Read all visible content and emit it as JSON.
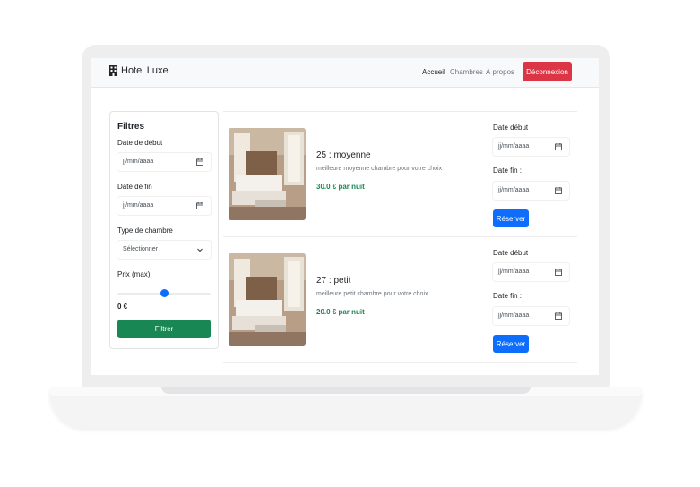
{
  "brand": {
    "name": "Hotel Luxe",
    "icon": "building-icon"
  },
  "nav": {
    "items": [
      "Accueil",
      "Chambres",
      "À propos"
    ],
    "logout": "Déconnexion"
  },
  "filters": {
    "title": "Filtres",
    "start_label": "Date de début",
    "start_placeholder": "jj/mm/aaaa",
    "end_label": "Date de fin",
    "end_placeholder": "jj/mm/aaaa",
    "type_label": "Type de chambre",
    "type_selected": "Sélectionner",
    "price_label": "Prix (max)",
    "price_level": 0.5,
    "price_value": "0 €",
    "submit": "Filtrer"
  },
  "rooms": [
    {
      "title": "25 : moyenne",
      "description": "meilleure moyenne chambre pour votre choix",
      "price": "30.0 € par nuit",
      "start_label": "Date début :",
      "start_placeholder": "jj/mm/aaaa",
      "end_label": "Date fin :",
      "end_placeholder": "jj/mm/aaaa",
      "button": "Réserver"
    },
    {
      "title": "27 : petit",
      "description": "meilleure petit chambre pour votre choix",
      "price": "20.0 € par nuit",
      "start_label": "Date début :",
      "start_placeholder": "jj/mm/aaaa",
      "end_label": "Date fin :",
      "end_placeholder": "jj/mm/aaaa",
      "button": "Réserver"
    }
  ],
  "colors": {
    "danger": "#dc3545",
    "success": "#198754",
    "primary": "#0d6efd"
  }
}
